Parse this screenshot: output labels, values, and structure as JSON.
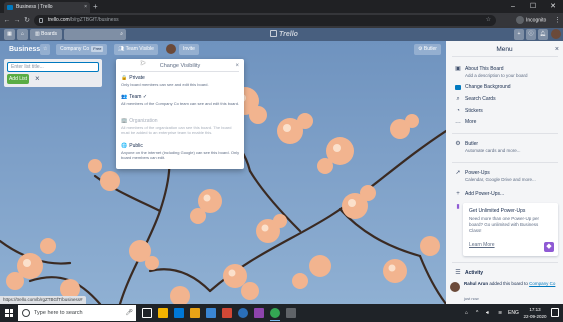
{
  "browser": {
    "tab_title": "Business | Trello",
    "tab_close": "×",
    "new_tab": "+",
    "url_host": "trello.com",
    "url_path": "/b/rgZTBGfT/business",
    "profile": "Incognito",
    "status_url": "https://trello.com/b/rgZTBGfT/business#"
  },
  "header": {
    "boards_label": "Boards",
    "logo": "Trello"
  },
  "board": {
    "name": "Business",
    "team": "Company Co",
    "team_badge": "Free",
    "visibility": "Team Visible",
    "invite": "Invite",
    "butler": "Butler"
  },
  "add_list": {
    "placeholder": "Enter list title...",
    "button": "Add List",
    "close": "×"
  },
  "visibility_popover": {
    "title": "Change Visibility",
    "close": "×",
    "options": [
      {
        "icon": "🔒",
        "title": "Private",
        "desc": "Only board members can see and edit this board."
      },
      {
        "icon": "👥",
        "title": "Team",
        "check": "✓",
        "desc": "All members of the Company Co team can see and edit this board."
      },
      {
        "icon": "🏢",
        "title": "Organization",
        "desc": "All members of the organization can see this board. The board must be added to an enterprise team to enable this."
      },
      {
        "icon": "🌐",
        "title": "Public",
        "desc": "Anyone on the internet (including Google) can see this board. Only board members can edit."
      }
    ]
  },
  "menu": {
    "title": "Menu",
    "close": "×",
    "about": {
      "title": "About This Board",
      "sub": "Add a description to your board"
    },
    "items": [
      "Change Background",
      "Search Cards",
      "Stickers",
      "More"
    ],
    "butler": {
      "title": "Butler",
      "sub": "Automate cards and more..."
    },
    "powerups": {
      "title": "Power-Ups",
      "sub": "Calendar, Google Drive and more..."
    },
    "add_powerups": "Add Power-Ups...",
    "promo": {
      "title": "Get Unlimited Power-Ups",
      "desc": "Need more than one Power-Up per board? Go unlimited with Business Class!",
      "link": "Learn More"
    },
    "activity": {
      "title": "Activity",
      "user": "Rahul Arun",
      "action": " added this board to ",
      "target": "Company Co",
      "time": "just now"
    }
  },
  "taskbar": {
    "search_placeholder": "Type here to search",
    "lang": "ENG",
    "time": "17:13",
    "date": "22-09-2020"
  }
}
